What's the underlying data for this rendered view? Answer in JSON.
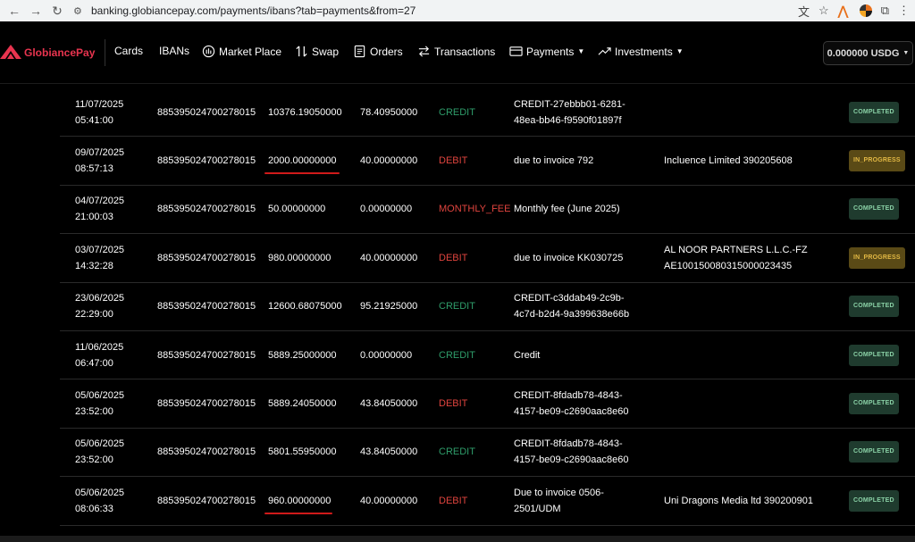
{
  "browser": {
    "url": "banking.globiancepay.com/payments/ibans?tab=payments&from=27"
  },
  "app": {
    "brand": "GlobiancePay",
    "nav": {
      "cards": "Cards",
      "ibans": "IBANs",
      "market": "Market Place",
      "swap": "Swap",
      "orders": "Orders",
      "transactions": "Transactions",
      "payments": "Payments",
      "investments": "Investments"
    },
    "balance": "0.000000 USDG"
  },
  "colors": {
    "brand": "#e8344f",
    "credit": "#2f9e6b",
    "debit": "#e0443e",
    "completed_badge": "#1f3b2e",
    "in_progress_badge": "#5a4a16"
  },
  "transactions": [
    {
      "date": "11/07/2025",
      "time": "05:41:00",
      "iban": "885395024700278015",
      "amount": "10376.19050000",
      "fee": "78.40950000",
      "type": "CREDIT",
      "desc1": "CREDIT-27ebbb01-6281-",
      "desc2": "48ea-bb46-f9590f01897f",
      "bene1": "",
      "bene2": "",
      "status": "COMPLETED"
    },
    {
      "date": "09/07/2025",
      "time": "08:57:13",
      "iban": "885395024700278015",
      "amount": "2000.00000000",
      "fee": "40.00000000",
      "type": "DEBIT",
      "desc1": "due to invoice 792",
      "desc2": "",
      "bene1": "Incluence Limited 390205608",
      "bene2": "",
      "status": "IN_PROGRESS"
    },
    {
      "date": "04/07/2025",
      "time": "21:00:03",
      "iban": "885395024700278015",
      "amount": "50.00000000",
      "fee": "0.00000000",
      "type": "MONTHLY_FEE",
      "desc1": "Monthly fee (June 2025)",
      "desc2": "",
      "bene1": "",
      "bene2": "",
      "status": "COMPLETED"
    },
    {
      "date": "03/07/2025",
      "time": "14:32:28",
      "iban": "885395024700278015",
      "amount": "980.00000000",
      "fee": "40.00000000",
      "type": "DEBIT",
      "desc1": "due to invoice KK030725",
      "desc2": "",
      "bene1": "AL NOOR PARTNERS L.L.C.-FZ",
      "bene2": "AE100150080315000023435",
      "status": "IN_PROGRESS"
    },
    {
      "date": "23/06/2025",
      "time": "22:29:00",
      "iban": "885395024700278015",
      "amount": "12600.68075000",
      "fee": "95.21925000",
      "type": "CREDIT",
      "desc1": "CREDIT-c3ddab49-2c9b-",
      "desc2": "4c7d-b2d4-9a399638e66b",
      "bene1": "",
      "bene2": "",
      "status": "COMPLETED"
    },
    {
      "date": "11/06/2025",
      "time": "06:47:00",
      "iban": "885395024700278015",
      "amount": "5889.25000000",
      "fee": "0.00000000",
      "type": "CREDIT",
      "desc1": "Credit",
      "desc2": "",
      "bene1": "",
      "bene2": "",
      "status": "COMPLETED"
    },
    {
      "date": "05/06/2025",
      "time": "23:52:00",
      "iban": "885395024700278015",
      "amount": "5889.24050000",
      "fee": "43.84050000",
      "type": "DEBIT",
      "desc1": "CREDIT-8fdadb78-4843-",
      "desc2": "4157-be09-c2690aac8e60",
      "bene1": "",
      "bene2": "",
      "status": "COMPLETED"
    },
    {
      "date": "05/06/2025",
      "time": "23:52:00",
      "iban": "885395024700278015",
      "amount": "5801.55950000",
      "fee": "43.84050000",
      "type": "CREDIT",
      "desc1": "CREDIT-8fdadb78-4843-",
      "desc2": "4157-be09-c2690aac8e60",
      "bene1": "",
      "bene2": "",
      "status": "COMPLETED"
    },
    {
      "date": "05/06/2025",
      "time": "08:06:33",
      "iban": "885395024700278015",
      "amount": "960.00000000",
      "fee": "40.00000000",
      "type": "DEBIT",
      "desc1": "Due to invoice 0506-",
      "desc2": "2501/UDM",
      "bene1": "Uni Dragons Media ltd 390200901",
      "bene2": "",
      "status": "COMPLETED"
    }
  ]
}
